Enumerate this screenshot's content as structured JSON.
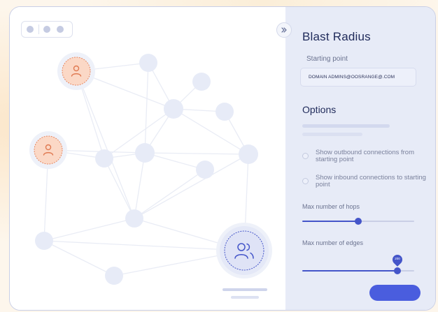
{
  "panel": {
    "title": "Blast Radius",
    "starting_point_label": "Starting point",
    "starting_point_value": "DOMAIN ADMINS@OOSRANGE@.COM",
    "options_title": "Options",
    "radio_outbound": "Show outbound connections from starting point",
    "radio_inbound": "Show inbound connections to starting point",
    "hops_label": "Max number of hops",
    "hops_value_fraction": 0.5,
    "edges_label": "Max number of edges",
    "edges_value": "200",
    "edges_value_fraction": 0.85,
    "action_button_label": "",
    "collapse_icon": "double-chevron-right-icon"
  },
  "graph": {
    "user_icon": "user-icon",
    "group_icon": "users-group-icon",
    "colors": {
      "user_node_fill": "#fbd8c6",
      "user_node_stroke": "#e8875f",
      "group_node_fill": "#dfe3f6",
      "group_node_stroke": "#4455c9",
      "node": "#e7ebf7",
      "edge": "#e9ecf5"
    }
  },
  "window": {
    "control_icons": [
      "dot-icon",
      "dot-icon",
      "dot-icon"
    ]
  }
}
